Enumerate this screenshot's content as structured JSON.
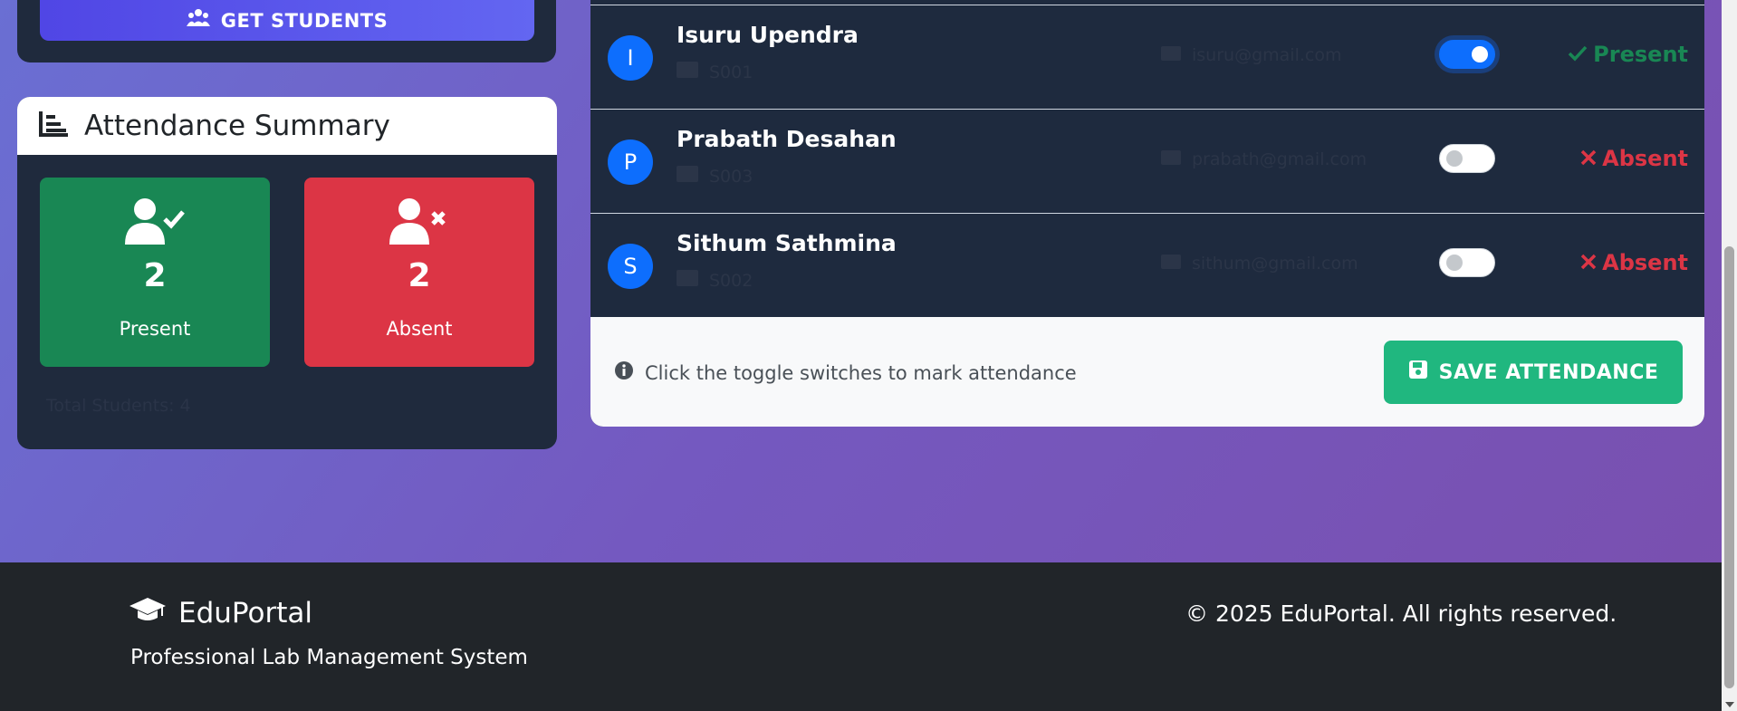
{
  "left": {
    "get_students_label": "GET STUDENTS",
    "summary_title": "Attendance Summary",
    "present_count": "2",
    "present_label": "Present",
    "absent_count": "2",
    "absent_label": "Absent",
    "total_students": "Total Students: 4"
  },
  "students": [
    {
      "initial": "I",
      "name": "Isuru Upendra",
      "id": "S001",
      "email": "isuru@gmail.com",
      "present": true,
      "status": "Present"
    },
    {
      "initial": "P",
      "name": "Prabath Desahan",
      "id": "S003",
      "email": "prabath@gmail.com",
      "present": false,
      "status": "Absent"
    },
    {
      "initial": "S",
      "name": "Sithum Sathmina",
      "id": "S002",
      "email": "sithum@gmail.com",
      "present": false,
      "status": "Absent"
    }
  ],
  "panel_footer": {
    "hint": "Click the toggle switches to mark attendance",
    "save_label": "SAVE ATTENDANCE"
  },
  "footer": {
    "brand": "EduPortal",
    "tagline": "Professional Lab Management System",
    "copyright": "© 2025 EduPortal. All rights reserved."
  },
  "colors": {
    "present": "#198754",
    "absent": "#dc3545",
    "accent": "#0d6efd",
    "save": "#20b77f"
  }
}
